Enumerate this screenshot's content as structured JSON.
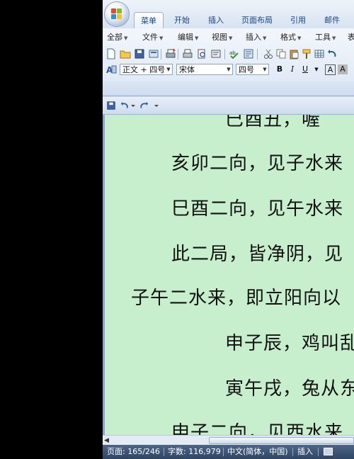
{
  "ribbon_tabs": [
    "菜单",
    "开始",
    "插入",
    "页面布局",
    "引用",
    "邮件"
  ],
  "menus": [
    "全部",
    "文件",
    "编辑",
    "视图",
    "插入",
    "格式",
    "工具",
    "表"
  ],
  "format": {
    "style": "正文 + 四号",
    "font": "宋体",
    "size": "四号",
    "bold": "B",
    "italic": "I",
    "underline": "U",
    "char_border": "A",
    "char_shade": "A"
  },
  "document_lines": [
    "巳酉丑，喔",
    "亥卯二向，见子水来",
    "巳酉二向，见午水来",
    "此二局，皆净阴，见",
    "子午二水来，即立阳向以",
    "申子辰，鸡叫乱",
    "寅午戌，兔从东",
    "申子二向，见西水来"
  ],
  "status": {
    "page": "页面: 165/246",
    "words": "字数: 116,979",
    "language": "中文(简体，中国)",
    "mode": "插入"
  },
  "colors": {
    "doc_background": "#c7efcd",
    "status_bar": "#3b5374",
    "ribbon": "#dbe6f4"
  }
}
